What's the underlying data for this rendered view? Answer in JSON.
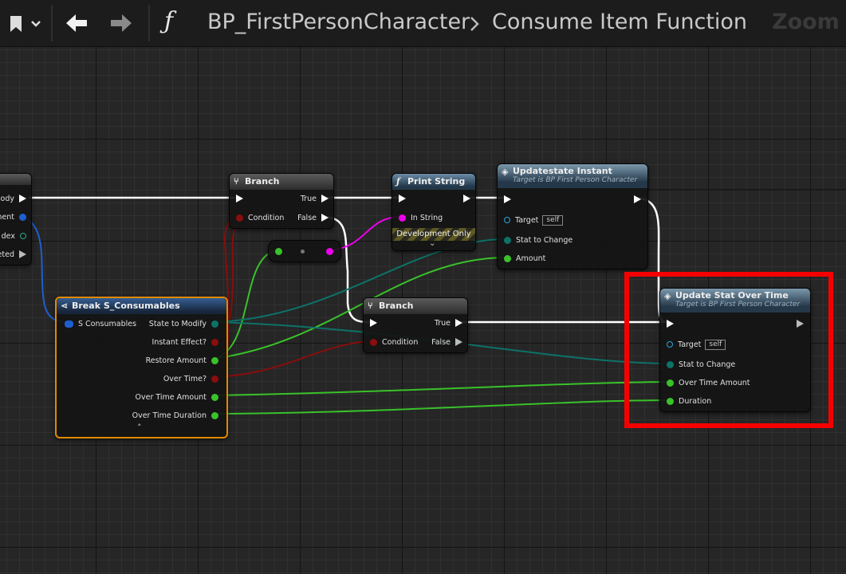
{
  "toolbar": {
    "bookmark_icon": "bookmark-icon",
    "back_icon": "arrow-left-icon",
    "forward_icon": "arrow-right-icon",
    "function_symbol": "ƒ",
    "breadcrumb_blueprint": "BP_FirstPersonCharacter",
    "breadcrumb_function": "Consume Item Function",
    "zoom_label": "Zoom -"
  },
  "entry_node": {
    "pins": [
      "ody",
      "ment",
      "dex",
      "eted"
    ]
  },
  "branch1": {
    "title": "Branch",
    "condition": "Condition",
    "true_label": "True",
    "false_label": "False"
  },
  "print_string": {
    "title": "Print String",
    "in_string": "In String",
    "dev_only": "Development Only"
  },
  "update_instant": {
    "title": "Updatestate Instant",
    "subtitle": "Target is BP First Person Character",
    "target": "Target",
    "self": "self",
    "stat_to_change": "Stat to Change",
    "amount": "Amount"
  },
  "break_node": {
    "title": "Break S_Consumables",
    "input": "S Consumables",
    "outputs": [
      "State to Modify",
      "Instant Effect?",
      "Restore Amount",
      "Over Time?",
      "Over Time Amount",
      "Over Time Duration"
    ]
  },
  "branch2": {
    "title": "Branch",
    "condition": "Condition",
    "true_label": "True",
    "false_label": "False"
  },
  "update_overtime": {
    "title": "Update Stat Over Time",
    "subtitle": "Target is BP First Person Character",
    "target": "Target",
    "self": "self",
    "stat_to_change": "Stat to Change",
    "over_time_amount": "Over Time Amount",
    "duration": "Duration"
  },
  "colors": {
    "exec": "#ffffff",
    "bool": "#8b0d0d",
    "float": "#39c22a",
    "string": "#ee00ee",
    "struct": "#1e5fcf",
    "enum": "#0d7268",
    "object": "#2fa3d6",
    "highlight": "#f50000",
    "selected": "#e08a00"
  }
}
